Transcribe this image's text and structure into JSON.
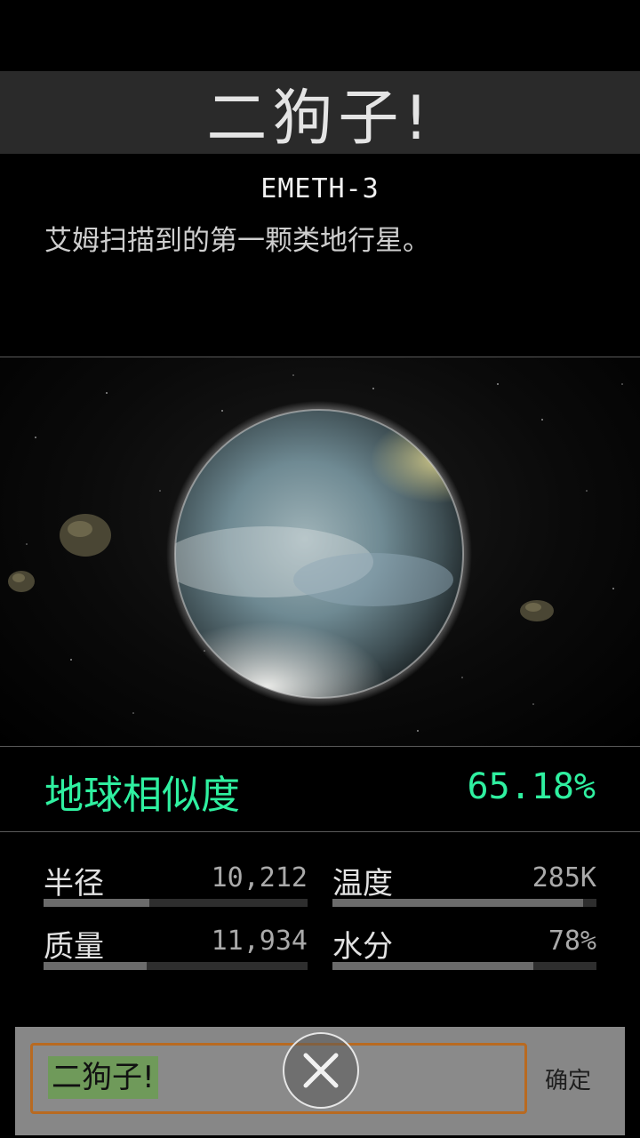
{
  "header": {
    "title": "二狗子!"
  },
  "planet": {
    "code": "EMETH-3",
    "description": "艾姆扫描到的第一颗类地行星。"
  },
  "similarity": {
    "label": "地球相似度",
    "value": "65.18%"
  },
  "stats": [
    {
      "label": "半径",
      "value": "10,212",
      "level": 0.4
    },
    {
      "label": "温度",
      "value": "285K",
      "level": 0.95
    },
    {
      "label": "质量",
      "value": "11,934",
      "level": 0.39
    },
    {
      "label": "水分",
      "value": "78%",
      "level": 0.76
    }
  ],
  "rename": {
    "input_value": "二狗子!",
    "confirm_label": "确定"
  },
  "colors": {
    "accent": "#2ff0a0",
    "input_border": "#b86a21",
    "selection": "#6f9a5a"
  }
}
